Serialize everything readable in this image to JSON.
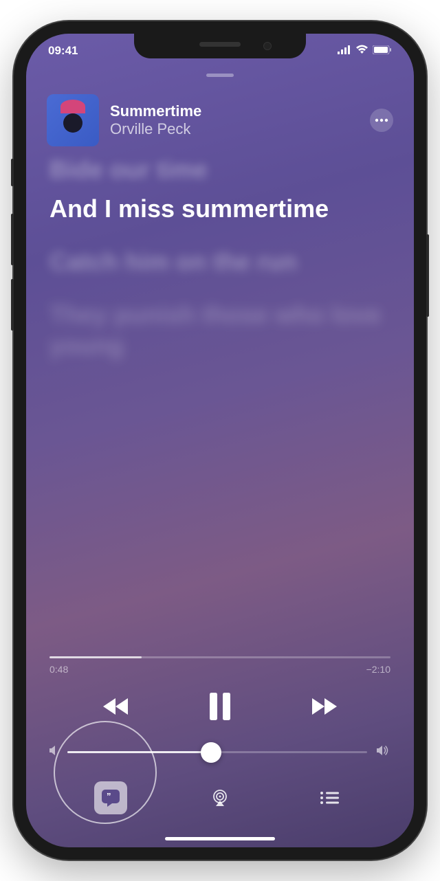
{
  "status": {
    "time": "09:41"
  },
  "track": {
    "title": "Summertime",
    "artist": "Orville Peck"
  },
  "lyrics": {
    "prev": "Bide our time",
    "current": "And I miss summertime",
    "next1": "Catch him on the run",
    "next2": "They punish those who love young"
  },
  "playback": {
    "elapsed": "0:48",
    "remaining": "−2:10",
    "progress_pct": 27,
    "volume_pct": 48
  }
}
